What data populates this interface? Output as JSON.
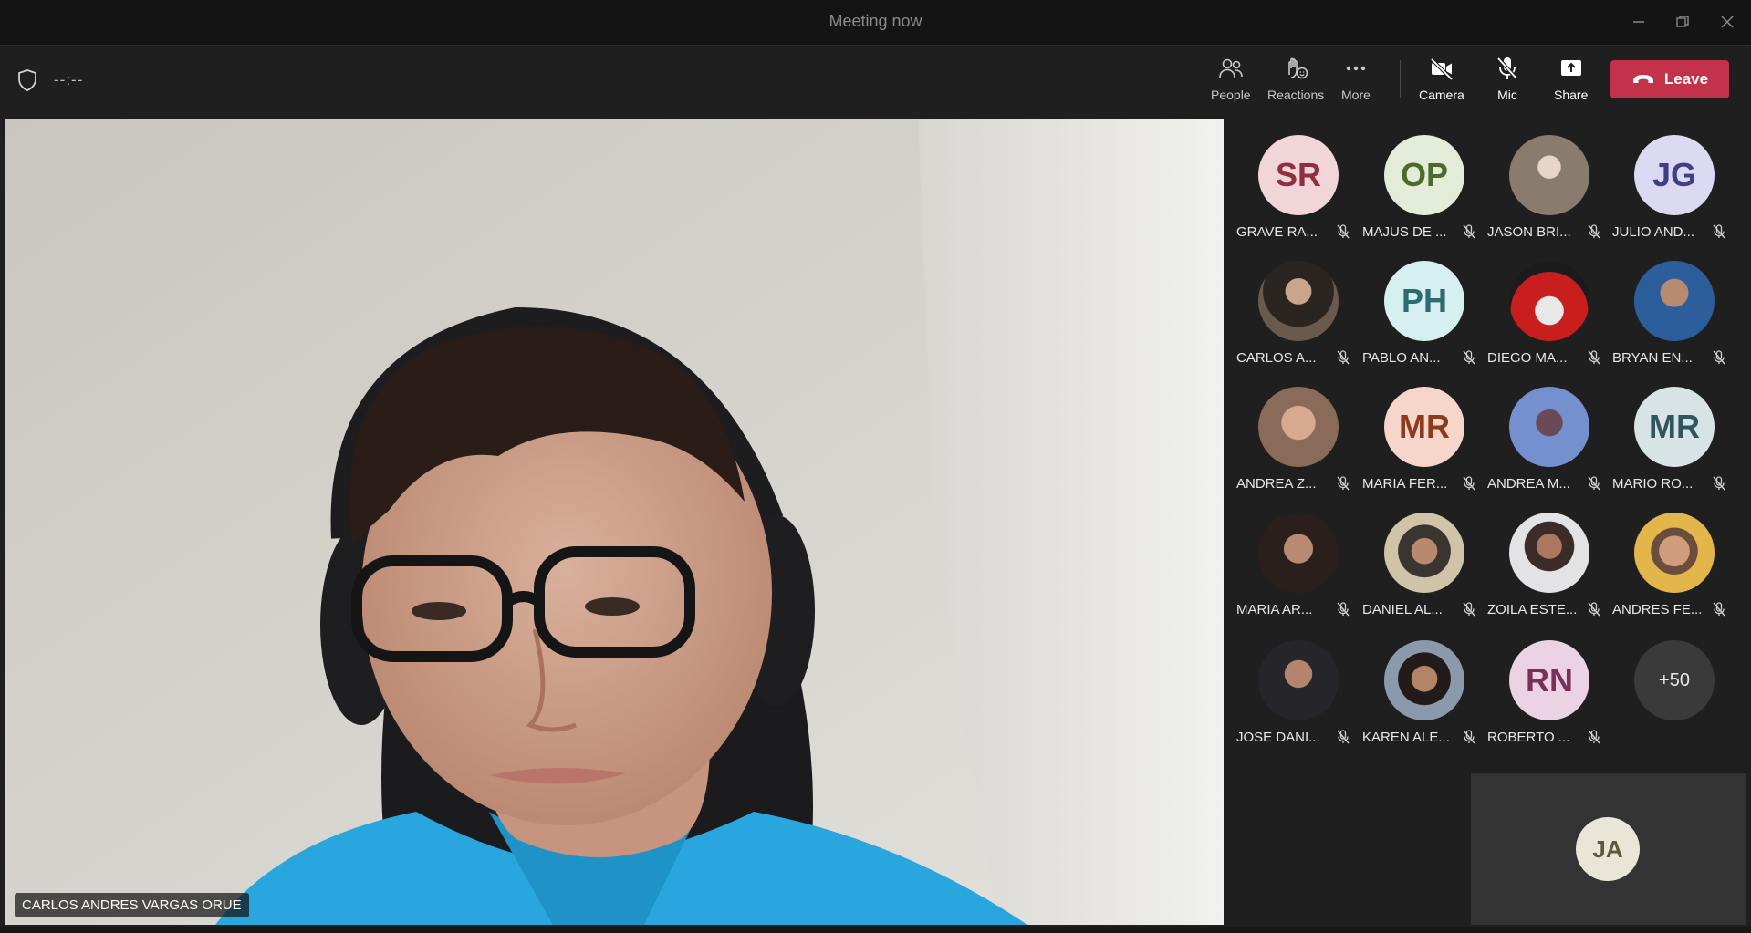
{
  "window": {
    "title": "Meeting now"
  },
  "toolbar": {
    "timer": "--:--",
    "buttons": [
      {
        "label": "People",
        "icon": "people-icon"
      },
      {
        "label": "Reactions",
        "icon": "reactions-icon"
      },
      {
        "label": "More",
        "icon": "more-icon"
      },
      {
        "label": "Camera",
        "icon": "camera-off-icon"
      },
      {
        "label": "Mic",
        "icon": "mic-off-icon"
      },
      {
        "label": "Share",
        "icon": "share-icon"
      }
    ],
    "leave_label": "Leave",
    "leave_color": "#c4314b"
  },
  "main_video": {
    "speaker_name": "CARLOS ANDRES VARGAS ORUE"
  },
  "participants": [
    {
      "name": "GRAVE RA...",
      "initials": "SR",
      "bg": "#f2d5d8",
      "fg": "#8f2f3f"
    },
    {
      "name": "MAJUS DE ...",
      "initials": "OP",
      "bg": "#e3ecd8",
      "fg": "#4e6a2b"
    },
    {
      "name": "JASON BRI...",
      "initials": "",
      "bg": "#8a7b6f",
      "fg": "#ffffff"
    },
    {
      "name": "JULIO AND...",
      "initials": "JG",
      "bg": "#dcd9f2",
      "fg": "#3e3f87"
    },
    {
      "name": "CARLOS A...",
      "initials": "",
      "bg": "#6a5a4e",
      "fg": "#ffffff"
    },
    {
      "name": "PABLO AN...",
      "initials": "PH",
      "bg": "#d6eff0",
      "fg": "#2c6b70"
    },
    {
      "name": "DIEGO MA...",
      "initials": "",
      "bg": "#b51d1d",
      "fg": "#ffffff"
    },
    {
      "name": "BRYAN EN...",
      "initials": "",
      "bg": "#3f6f9c",
      "fg": "#ffffff"
    },
    {
      "name": "ANDREA Z...",
      "initials": "",
      "bg": "#c79a84",
      "fg": "#ffffff"
    },
    {
      "name": "MARIA FER...",
      "initials": "MR",
      "bg": "#f6d6cb",
      "fg": "#8c3a1c"
    },
    {
      "name": "ANDREA M...",
      "initials": "",
      "bg": "#6d86c6",
      "fg": "#ffffff"
    },
    {
      "name": "MARIO RO...",
      "initials": "MR",
      "bg": "#d8e3e6",
      "fg": "#2f5660"
    },
    {
      "name": "MARIA AR...",
      "initials": "",
      "bg": "#3d2a27",
      "fg": "#ffffff"
    },
    {
      "name": "DANIEL AL...",
      "initials": "",
      "bg": "#5c5248",
      "fg": "#ffffff"
    },
    {
      "name": "ZOILA ESTE...",
      "initials": "",
      "bg": "#b9aab0",
      "fg": "#ffffff"
    },
    {
      "name": "ANDRES FE...",
      "initials": "",
      "bg": "#d7a743",
      "fg": "#ffffff"
    },
    {
      "name": "JOSE DANI...",
      "initials": "",
      "bg": "#4b4a3f",
      "fg": "#ffffff"
    },
    {
      "name": "KAREN ALE...",
      "initials": "",
      "bg": "#4c5a6b",
      "fg": "#ffffff"
    },
    {
      "name": "ROBERTO ...",
      "initials": "RN",
      "bg": "#ecd3e4",
      "fg": "#7a2f5b"
    }
  ],
  "overflow_count": "+50",
  "self_view": {
    "initials": "JA"
  }
}
